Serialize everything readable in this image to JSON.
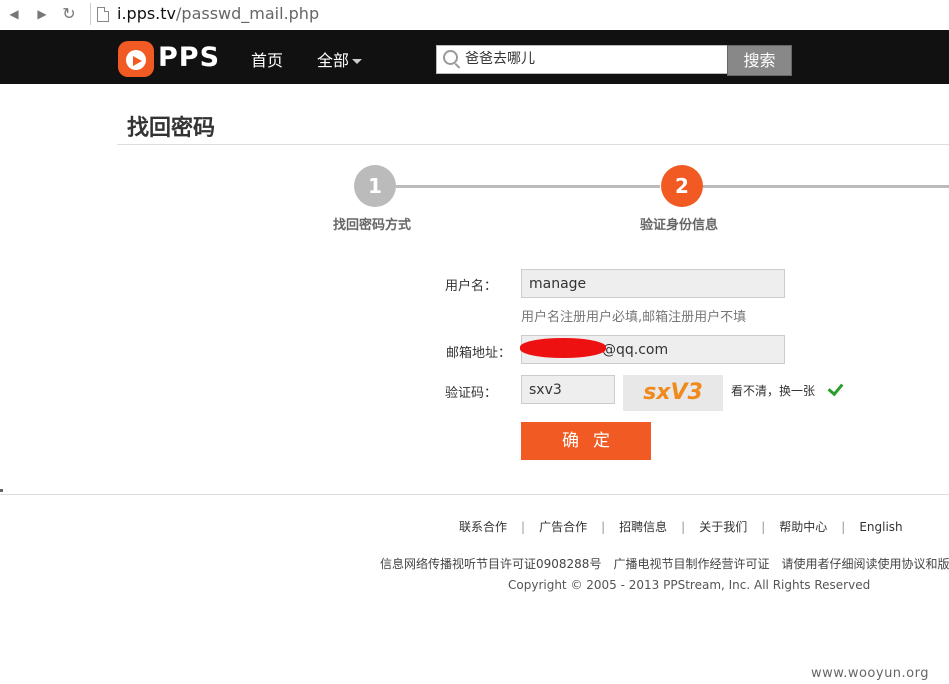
{
  "browser": {
    "url_host": "i.pps.tv",
    "url_path": "/passwd_mail.php"
  },
  "header": {
    "logo_text": "PPS",
    "nav_home": "首页",
    "nav_all": "全部",
    "search_value": "爸爸去哪儿",
    "search_button": "搜索"
  },
  "page": {
    "title": "找回密码"
  },
  "steps": [
    {
      "number": "1",
      "label": "找回密码方式",
      "active": false
    },
    {
      "number": "2",
      "label": "验证身份信息",
      "active": true
    }
  ],
  "form": {
    "username_label": "用户名：",
    "username_value": "manage",
    "username_hint": "用户名注册用户必填,邮箱注册用户不填",
    "email_label": "邮箱地址：",
    "email_value": "@qq.com",
    "captcha_label": "验证码：",
    "captcha_value": "sxv3",
    "captcha_image_text": "sxV3",
    "refresh_link": "看不清，换一张",
    "submit_label": "确定"
  },
  "footer": {
    "links": [
      "联系合作",
      "广告合作",
      "招聘信息",
      "关于我们",
      "帮助中心",
      "English"
    ],
    "license_items": [
      "信息网络传播视听节目许可证0908288号",
      "广播电视节目制作经营许可证",
      "请使用者仔细阅读使用协议和版"
    ],
    "copyright": "Copyright © 2005 - 2013 PPStream, Inc. All Rights Reserved"
  },
  "watermark": "www.wooyun.org",
  "colors": {
    "accent": "#f15a22",
    "header_bg": "#111111",
    "inactive_step": "#bbbbbb"
  }
}
